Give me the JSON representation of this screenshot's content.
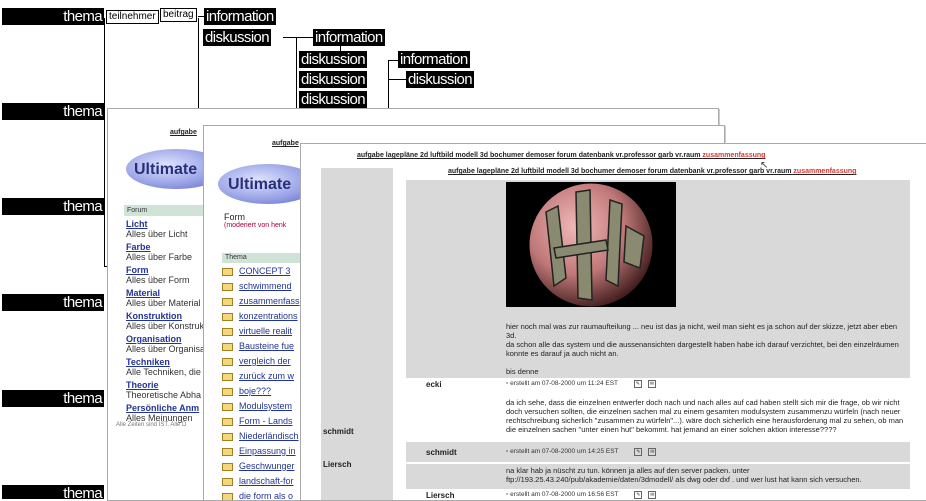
{
  "labels": {
    "thema": "thema",
    "teilnehmer": "teilnehmer",
    "beitrag": "beitrag",
    "information": "information",
    "diskussion": "diskussion"
  },
  "nav": {
    "prefix": "aufgabe",
    "main": "aufgabe lagepläne 2d luftbild modell 3d bochumer demoser forum datenbank vr.professor garb vr.raum",
    "last": "zusammenfassung"
  },
  "logo": {
    "text": "Ultimate"
  },
  "sidebar": {
    "header": "Forum",
    "items": [
      {
        "title": "Licht",
        "desc": "Alles über Licht"
      },
      {
        "title": "Farbe",
        "desc": "Alles über Farbe"
      },
      {
        "title": "Form",
        "desc": "Alles über Form"
      },
      {
        "title": "Material",
        "desc": "Alles über Material"
      },
      {
        "title": "Konstruktion",
        "desc": "Alles über Konstrukt"
      },
      {
        "title": "Organisation",
        "desc": "Alles über Organisa"
      },
      {
        "title": "Techniken",
        "desc": "Alle Techniken, die"
      },
      {
        "title": "Theorie",
        "desc": "Theoretische Abha"
      },
      {
        "title": "Persönliche Anm",
        "desc": "Alles Meinungen"
      }
    ],
    "footer": "Alle Zeiten sind IST. Alle D"
  },
  "form": {
    "title": "Form",
    "moderator": "(moderiert von henk",
    "thema_header": "Thema",
    "topics": [
      "CONCEPT 3",
      "schwimmend",
      "zusammenfass",
      "konzentrations",
      "virtuelle realit",
      "Bausteine fue",
      "vergleich der",
      "zurück zum w",
      "boje???",
      "Modulsystem",
      "Form - Lands",
      "Niederländisch",
      "Einpassung in",
      "Geschwunger",
      "landschaft-for",
      "die form als o"
    ]
  },
  "thread": {
    "left_authors": [
      "schmidt",
      "Liersch"
    ],
    "post1_text": "hier noch mal was zur raumaufteilung ... neu ist das ja nicht, weil man sieht es ja schon auf der skizze, jetzt aber eben 3d.\nda schon alle das system und die aussenansichten dargestellt haben habe ich darauf verzichtet, bei den einzelräumen konnte es darauf ja auch nicht an.\n\nbis denne",
    "post1_author": "ecki",
    "post1_meta": "erstellt am 07-08-2000 um 11:24 EST",
    "post2_text": "da ich sehe, dass die einzelnen entwerfer doch nach und nach alles auf cad haben stellt sich mir die frage, ob wir nicht doch versuchen sollten, die einzelnen sachen mal zu einem gesamten modulsystem zusammenzu würfeln (nach neuer rechtschreibung sicherlich \"zusammen zu würfeln\"...). wäre doch sicherlich eine herausforderung mal zu sehen, ob man die einzelnen sachen \"unter einen hut\" bekommt. hat jemand an einer solchen aktion interesse????",
    "post2_author": "schmidt",
    "post2_meta": "erstellt am 07-08-2000 um 14:25 EST",
    "post3_text": "na klar hab ja nüscht zu tun. können ja alles auf den server packen. unter\nftp://193.25.43.240/pub/akademie/daten/3dmodell/ als dwg oder dxf . und wer lust hat kann sich versuchen.",
    "post3_author": "Liersch",
    "post3_meta": "erstellt am 07-08-2000 um 16:56 EST"
  }
}
